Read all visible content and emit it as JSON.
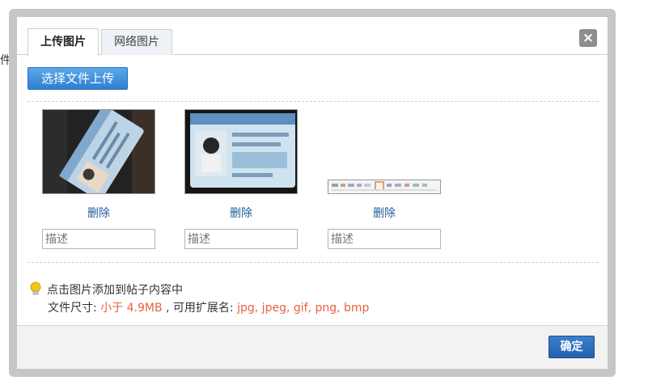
{
  "background": {
    "text": "件直"
  },
  "dialog": {
    "tabs": [
      {
        "label": "上传图片",
        "active": true
      },
      {
        "label": "网络图片",
        "active": false
      }
    ],
    "close_label": "×",
    "upload_button": "选择文件上传",
    "images": [
      {
        "delete_label": "删除",
        "desc_placeholder": "描述",
        "icon": "id-card-photo-tilted"
      },
      {
        "delete_label": "删除",
        "desc_placeholder": "描述",
        "icon": "id-card-photo"
      },
      {
        "delete_label": "删除",
        "desc_placeholder": "描述",
        "icon": "toolbar-screenshot"
      }
    ],
    "tips": {
      "line1": "点击图片添加到帖子内容中",
      "size_label": "文件尺寸: ",
      "size_value": "小于 4.9MB",
      "ext_label": " , 可用扩展名: ",
      "ext_value": "jpg, jpeg, gif, png, bmp"
    },
    "ok_button": "确定"
  },
  "colors": {
    "accent_orange": "#e8603c",
    "link_blue": "#1e5c9c",
    "button_blue": "#2f7fd0"
  }
}
